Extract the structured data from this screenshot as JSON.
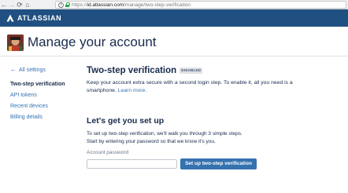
{
  "browser": {
    "url_scheme": "https://",
    "url_host": "id.atlassian.com",
    "url_path": "/manage/two-step-verification",
    "back_glyph": "←",
    "forward_glyph": "→",
    "reload_glyph": "⟳",
    "home_glyph": "⌂",
    "info_glyph": "i",
    "icons": [
      "back-arrow-icon",
      "forward-arrow-icon",
      "reload-icon",
      "home-icon",
      "info-icon",
      "lock-icon"
    ]
  },
  "header": {
    "brand": "ATLASSIAN",
    "background_color": "#205081",
    "logo_icon": "atlassian-logo-icon"
  },
  "page": {
    "title": "Manage your account",
    "avatar_icon": "user-avatar"
  },
  "sidebar": {
    "back_label": "All settings",
    "back_icon": "arrow-left-icon",
    "back_glyph": "←",
    "items": [
      {
        "label": "Two-step verification",
        "active": true
      },
      {
        "label": "API tokens",
        "active": false
      },
      {
        "label": "Recent devices",
        "active": false
      },
      {
        "label": "Billing details",
        "active": false
      }
    ]
  },
  "main": {
    "title": "Two-step verification",
    "status": "DISABLED",
    "intro_text": "Keep your account extra secure with a second login step. To enable it, all you need is a smartphone.",
    "learn_more": "Learn more.",
    "setup_heading": "Let's get you set up",
    "setup_line1": "To set up two-step verification, we'll walk you through 3 simple steps.",
    "setup_line2": "Start by entering your password so that we know it's you.",
    "password_label": "Account password",
    "password_value": "",
    "setup_button": "Set up two-step verification",
    "link_color": "#3572b0"
  }
}
